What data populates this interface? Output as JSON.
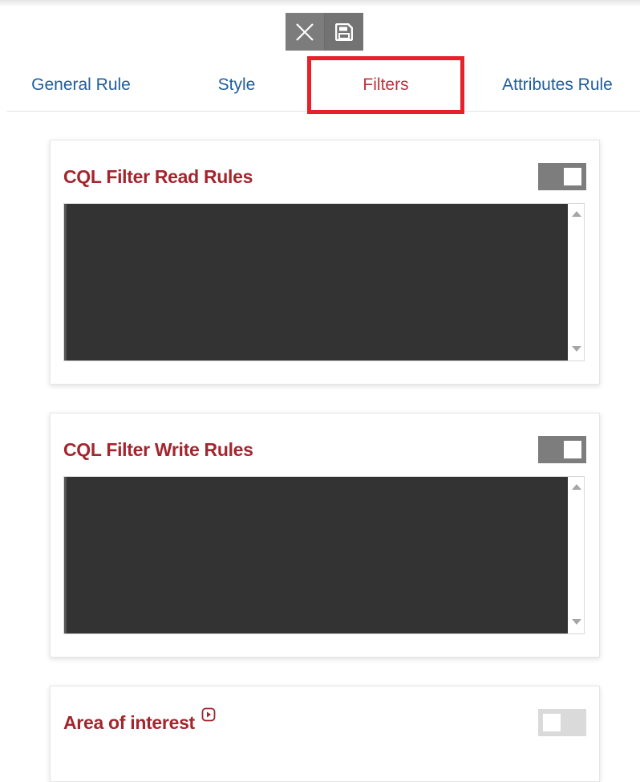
{
  "toolbar": {
    "buttons": [
      {
        "icon": "close-icon",
        "label": "Close"
      },
      {
        "icon": "save-icon",
        "label": "Save"
      }
    ]
  },
  "tabs": [
    {
      "label": "General Rule",
      "active": false
    },
    {
      "label": "Style",
      "active": false
    },
    {
      "label": "Filters",
      "active": true
    },
    {
      "label": "Attributes Rule",
      "active": false
    }
  ],
  "panels": {
    "read": {
      "title": "CQL Filter Read Rules",
      "toggle": "on",
      "value": ""
    },
    "write": {
      "title": "CQL Filter Write Rules",
      "toggle": "on",
      "value": ""
    },
    "area": {
      "title": "Area of interest",
      "toggle": "off",
      "info_icon": "info-play-icon"
    }
  },
  "colors": {
    "tab_link": "#1f5d9c",
    "tab_active": "#c0303b",
    "panel_title": "#a3252e",
    "highlight": "#e8202a",
    "editor_bg": "#333333",
    "toggle_on": "#7d7d7d",
    "toggle_off": "#dadada"
  }
}
